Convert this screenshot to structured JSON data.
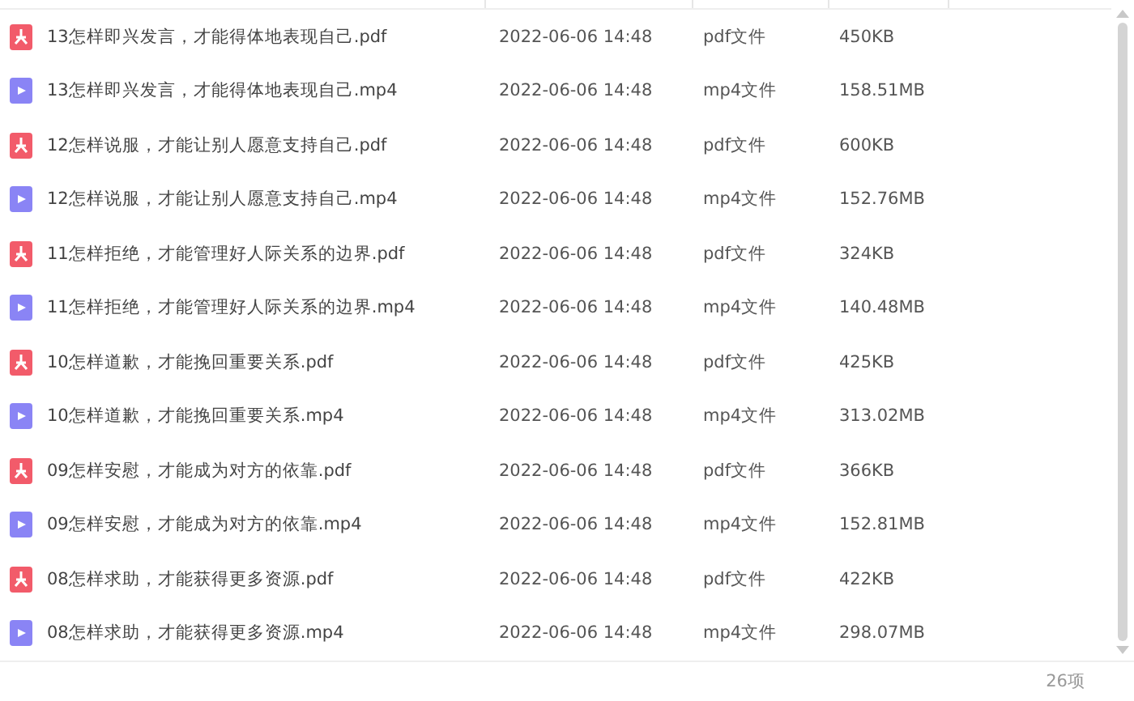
{
  "files": [
    {
      "kind": "pdf",
      "name": "13怎样即兴发言，才能得体地表现自己.pdf",
      "date": "2022-06-06 14:48",
      "type": "pdf文件",
      "size": "450KB"
    },
    {
      "kind": "video",
      "name": "13怎样即兴发言，才能得体地表现自己.mp4",
      "date": "2022-06-06 14:48",
      "type": "mp4文件",
      "size": "158.51MB"
    },
    {
      "kind": "pdf",
      "name": "12怎样说服，才能让别人愿意支持自己.pdf",
      "date": "2022-06-06 14:48",
      "type": "pdf文件",
      "size": "600KB"
    },
    {
      "kind": "video",
      "name": "12怎样说服，才能让别人愿意支持自己.mp4",
      "date": "2022-06-06 14:48",
      "type": "mp4文件",
      "size": "152.76MB"
    },
    {
      "kind": "pdf",
      "name": "11怎样拒绝，才能管理好人际关系的边界.pdf",
      "date": "2022-06-06 14:48",
      "type": "pdf文件",
      "size": "324KB"
    },
    {
      "kind": "video",
      "name": "11怎样拒绝，才能管理好人际关系的边界.mp4",
      "date": "2022-06-06 14:48",
      "type": "mp4文件",
      "size": "140.48MB"
    },
    {
      "kind": "pdf",
      "name": "10怎样道歉，才能挽回重要关系.pdf",
      "date": "2022-06-06 14:48",
      "type": "pdf文件",
      "size": "425KB"
    },
    {
      "kind": "video",
      "name": "10怎样道歉，才能挽回重要关系.mp4",
      "date": "2022-06-06 14:48",
      "type": "mp4文件",
      "size": "313.02MB"
    },
    {
      "kind": "pdf",
      "name": "09怎样安慰，才能成为对方的依靠.pdf",
      "date": "2022-06-06 14:48",
      "type": "pdf文件",
      "size": "366KB"
    },
    {
      "kind": "video",
      "name": "09怎样安慰，才能成为对方的依靠.mp4",
      "date": "2022-06-06 14:48",
      "type": "mp4文件",
      "size": "152.81MB"
    },
    {
      "kind": "pdf",
      "name": "08怎样求助，才能获得更多资源.pdf",
      "date": "2022-06-06 14:48",
      "type": "pdf文件",
      "size": "422KB"
    },
    {
      "kind": "video",
      "name": "08怎样求助，才能获得更多资源.mp4",
      "date": "2022-06-06 14:48",
      "type": "mp4文件",
      "size": "298.07MB"
    }
  ],
  "status_bar": {
    "count": "26项"
  }
}
